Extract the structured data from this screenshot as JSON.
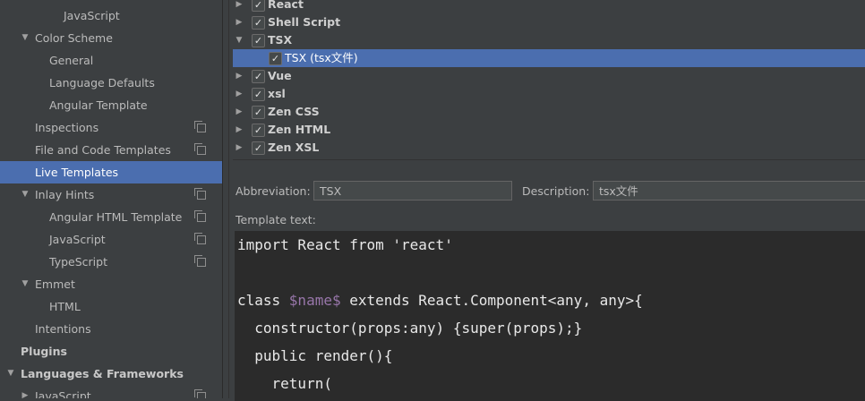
{
  "sidebar": {
    "items": [
      {
        "label": "JavaScript",
        "indent": 4,
        "arrow": "",
        "bold": false,
        "selected": false,
        "copy": false
      },
      {
        "label": "Color Scheme",
        "indent": 2,
        "arrow": "down",
        "bold": false,
        "selected": false,
        "copy": false
      },
      {
        "label": "General",
        "indent": 3,
        "arrow": "",
        "bold": false,
        "selected": false,
        "copy": false
      },
      {
        "label": "Language Defaults",
        "indent": 3,
        "arrow": "",
        "bold": false,
        "selected": false,
        "copy": false
      },
      {
        "label": "Angular Template",
        "indent": 3,
        "arrow": "",
        "bold": false,
        "selected": false,
        "copy": false
      },
      {
        "label": "Inspections",
        "indent": 2,
        "arrow": "",
        "bold": false,
        "selected": false,
        "copy": true
      },
      {
        "label": "File and Code Templates",
        "indent": 2,
        "arrow": "",
        "bold": false,
        "selected": false,
        "copy": true
      },
      {
        "label": "Live Templates",
        "indent": 2,
        "arrow": "",
        "bold": false,
        "selected": true,
        "copy": false
      },
      {
        "label": "Inlay Hints",
        "indent": 2,
        "arrow": "down",
        "bold": false,
        "selected": false,
        "copy": true
      },
      {
        "label": "Angular HTML Template",
        "indent": 3,
        "arrow": "",
        "bold": false,
        "selected": false,
        "copy": true
      },
      {
        "label": "JavaScript",
        "indent": 3,
        "arrow": "",
        "bold": false,
        "selected": false,
        "copy": true
      },
      {
        "label": "TypeScript",
        "indent": 3,
        "arrow": "",
        "bold": false,
        "selected": false,
        "copy": true
      },
      {
        "label": "Emmet",
        "indent": 2,
        "arrow": "down",
        "bold": false,
        "selected": false,
        "copy": false
      },
      {
        "label": "HTML",
        "indent": 3,
        "arrow": "",
        "bold": false,
        "selected": false,
        "copy": false
      },
      {
        "label": "Intentions",
        "indent": 2,
        "arrow": "",
        "bold": false,
        "selected": false,
        "copy": false
      },
      {
        "label": "Plugins",
        "indent": 1,
        "arrow": "",
        "bold": true,
        "selected": false,
        "copy": false
      },
      {
        "label": "Languages & Frameworks",
        "indent": 1,
        "arrow": "down",
        "bold": true,
        "selected": false,
        "copy": false
      },
      {
        "label": "JavaScript",
        "indent": 2,
        "arrow": "right",
        "bold": false,
        "selected": false,
        "copy": true
      }
    ]
  },
  "template_tree": {
    "groups": [
      {
        "label": "React",
        "arrow": "right",
        "checked": true,
        "bold": true,
        "selected": false,
        "child": false
      },
      {
        "label": "Shell Script",
        "arrow": "right",
        "checked": true,
        "bold": true,
        "selected": false,
        "child": false
      },
      {
        "label": "TSX",
        "arrow": "down",
        "checked": true,
        "bold": true,
        "selected": false,
        "child": false
      },
      {
        "label": "TSX (tsx文件)",
        "arrow": "",
        "checked": true,
        "bold": false,
        "selected": true,
        "child": true
      },
      {
        "label": "Vue",
        "arrow": "right",
        "checked": true,
        "bold": true,
        "selected": false,
        "child": false
      },
      {
        "label": "xsl",
        "arrow": "right",
        "checked": true,
        "bold": true,
        "selected": false,
        "child": false
      },
      {
        "label": "Zen CSS",
        "arrow": "right",
        "checked": true,
        "bold": true,
        "selected": false,
        "child": false
      },
      {
        "label": "Zen HTML",
        "arrow": "right",
        "checked": true,
        "bold": true,
        "selected": false,
        "child": false
      },
      {
        "label": "Zen XSL",
        "arrow": "right",
        "checked": true,
        "bold": true,
        "selected": false,
        "child": false
      }
    ]
  },
  "form": {
    "abbreviation_label": "Abbreviation:",
    "abbreviation_value": "TSX",
    "description_label": "Description:",
    "description_value": "tsx文件",
    "template_text_label": "Template text:"
  },
  "editor": {
    "lines": [
      [
        {
          "t": "import React from 'react'"
        }
      ],
      [],
      [
        {
          "t": "class "
        },
        {
          "t": "$name$",
          "var": true
        },
        {
          "t": " extends React.Component<any, any>{"
        }
      ],
      [
        {
          "t": "  constructor(props:any) {super(props);}"
        }
      ],
      [
        {
          "t": "  public render(){"
        }
      ],
      [
        {
          "t": "    return("
        }
      ]
    ]
  },
  "colors": {
    "background": "#3c3f41",
    "selection": "#4b6eaf",
    "editor_bg": "#2b2b2b",
    "variable": "#9876aa"
  },
  "icons": {
    "expanded": "triangle-down-icon",
    "collapsed": "triangle-right-icon",
    "copy": "copy-settings-icon",
    "checkbox": "checkbox-checked-icon"
  }
}
